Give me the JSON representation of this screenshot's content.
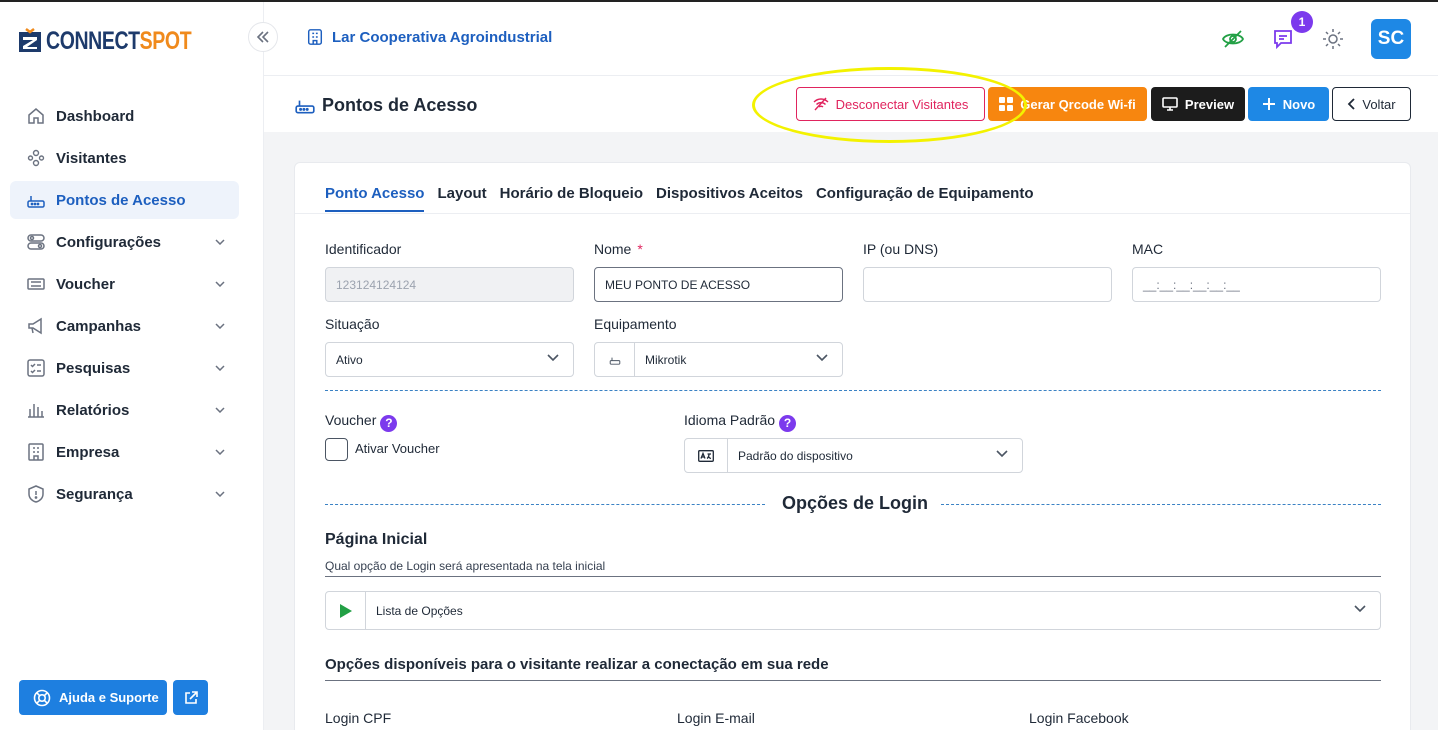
{
  "brand": {
    "logo_part1": "CONNECT",
    "logo_part2": "SPOT",
    "primary": "#1d5fbf",
    "accent": "#f08a1c"
  },
  "sidebar": {
    "collapse_icon": "double-chevron-left-icon",
    "items": [
      {
        "label": "Dashboard",
        "icon": "home-icon",
        "active": false,
        "expandable": false
      },
      {
        "label": "Visitantes",
        "icon": "users-icon",
        "active": false,
        "expandable": false
      },
      {
        "label": "Pontos de Acesso",
        "icon": "router-icon",
        "active": true,
        "expandable": false
      },
      {
        "label": "Configurações",
        "icon": "toggles-icon",
        "active": false,
        "expandable": true
      },
      {
        "label": "Voucher",
        "icon": "ticket-icon",
        "active": false,
        "expandable": true
      },
      {
        "label": "Campanhas",
        "icon": "megaphone-icon",
        "active": false,
        "expandable": true
      },
      {
        "label": "Pesquisas",
        "icon": "checklist-icon",
        "active": false,
        "expandable": true
      },
      {
        "label": "Relatórios",
        "icon": "bar-chart-icon",
        "active": false,
        "expandable": true
      },
      {
        "label": "Empresa",
        "icon": "building-icon",
        "active": false,
        "expandable": true
      },
      {
        "label": "Segurança",
        "icon": "shield-icon",
        "active": false,
        "expandable": true
      }
    ],
    "help_label": "Ajuda e Suporte"
  },
  "header": {
    "company": "Lar Cooperativa Agroindustrial",
    "notification_count": "1",
    "avatar_initials": "SC"
  },
  "page": {
    "title": "Pontos de Acesso",
    "buttons": {
      "disconnect": "Desconectar Visitantes",
      "qrcode": "Gerar Qrcode Wi-fi",
      "preview": "Preview",
      "new": "Novo",
      "back": "Voltar"
    }
  },
  "tabs": [
    "Ponto Acesso",
    "Layout",
    "Horário de Bloqueio",
    "Dispositivos Aceitos",
    "Configuração de Equipamento"
  ],
  "form": {
    "identificador": {
      "label": "Identificador",
      "value": "123124124124"
    },
    "nome": {
      "label": "Nome",
      "required": "*",
      "value": "MEU PONTO DE ACESSO"
    },
    "ip": {
      "label": "IP (ou DNS)",
      "value": ""
    },
    "mac": {
      "label": "MAC",
      "placeholder": "__:__:__:__:__:__"
    },
    "situacao": {
      "label": "Situação",
      "value": "Ativo"
    },
    "equipamento": {
      "label": "Equipamento",
      "value": "Mikrotik"
    },
    "voucher": {
      "label": "Voucher",
      "checkbox_label": "Ativar Voucher",
      "checked": false
    },
    "idioma": {
      "label": "Idioma Padrão",
      "value": "Padrão do dispositivo"
    },
    "help_marker": "?"
  },
  "login": {
    "section_title": "Opções de Login",
    "start_page_title": "Página Inicial",
    "start_page_help": "Qual opção de Login será apresentada na tela inicial",
    "start_page_value": "Lista de Opções",
    "options_title": "Opções disponíveis para o visitante realizar a conectação em sua rede",
    "options": [
      "Login CPF",
      "Login E-mail",
      "Login Facebook"
    ]
  }
}
